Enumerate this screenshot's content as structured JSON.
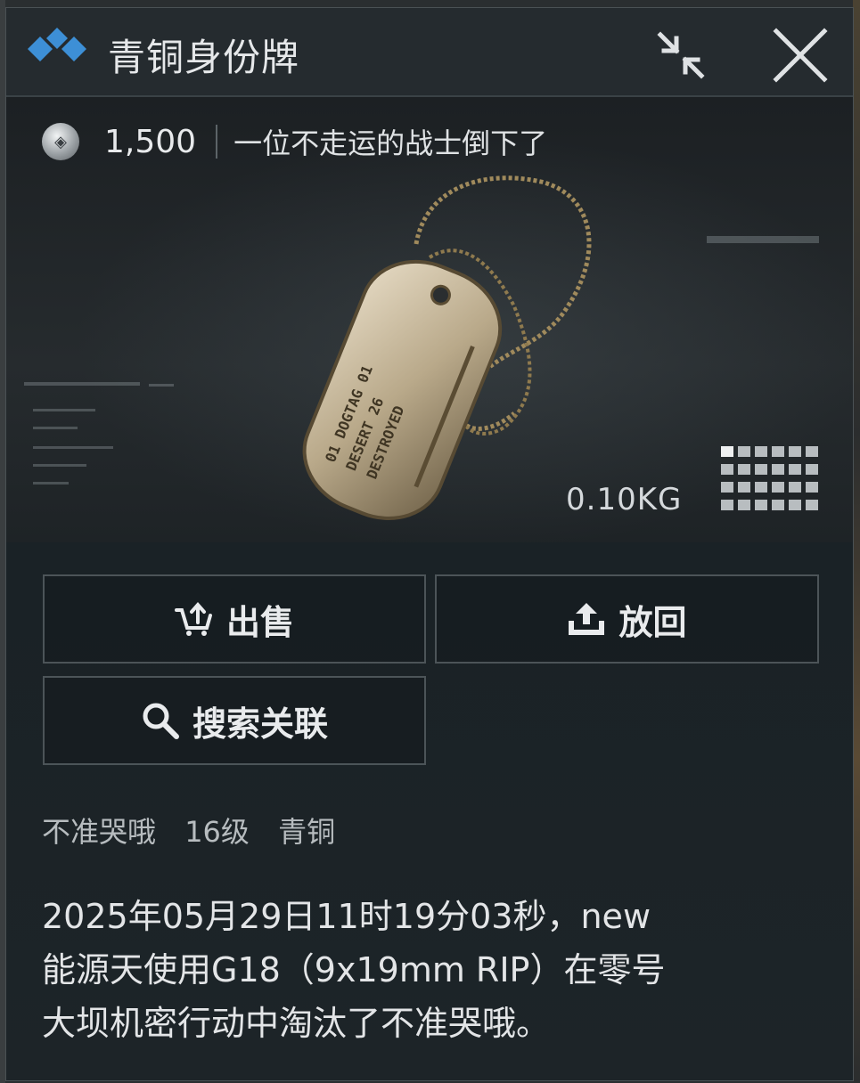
{
  "window": {
    "title": "青铜身份牌"
  },
  "item": {
    "price": "1,500",
    "slogan": "一位不走运的战士倒下了",
    "weight": "0.10KG",
    "tag_lines": [
      "01 DOGTAG 01",
      "DESERT 26",
      "DESTROYED"
    ]
  },
  "actions": {
    "sell_label": "出售",
    "return_label": "放回",
    "search_label": "搜索关联"
  },
  "owner": {
    "name": "不准哭哦",
    "level": "16级",
    "rank": "青铜"
  },
  "description": {
    "lines": [
      "2025年05月29日11时19分03秒，new",
      "能源天使用G18（9x19mm RIP）在零号",
      "大坝机密行动中淘汰了不准哭哦。"
    ]
  },
  "colors": {
    "accent": "#3d8fd6",
    "panel_bg": "#1b2327",
    "border": "#4c5458"
  },
  "icons": {
    "logo": "diamond-logo-icon",
    "minimize": "collapse-arrows-icon",
    "close": "close-icon",
    "currency": "coin-icon",
    "size": "grid-size-icon",
    "sell": "sell-cart-icon",
    "return": "upload-icon",
    "search": "search-icon"
  }
}
